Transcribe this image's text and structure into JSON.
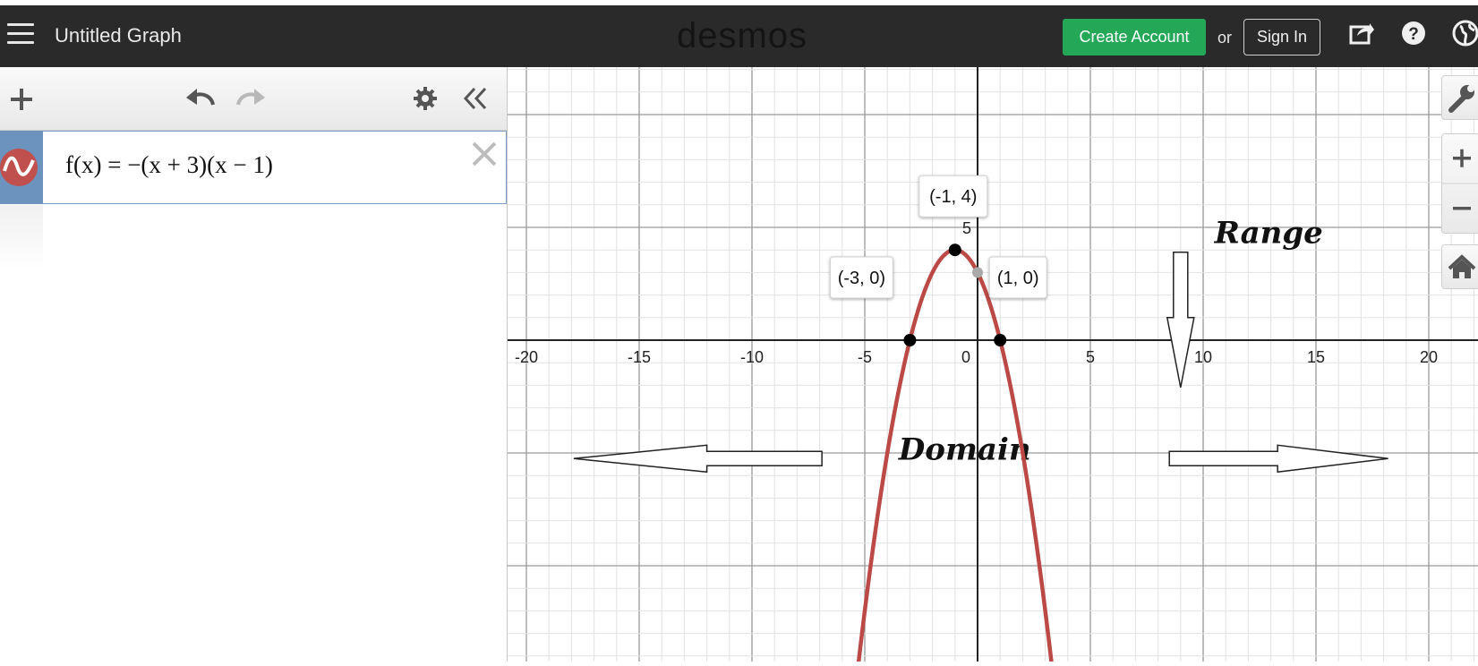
{
  "header": {
    "title": "Untitled Graph",
    "logo": "desmos",
    "create_account": "Create Account",
    "or": "or",
    "sign_in": "Sign In"
  },
  "expression_list": [
    {
      "latex_display": "f(x) = −(x + 3)(x − 1)",
      "color": "#c0504d"
    }
  ],
  "graph": {
    "x_ticks": [
      "-20",
      "-15",
      "-10",
      "-5",
      "0",
      "5",
      "10",
      "15",
      "20"
    ],
    "y_tick_label": "5",
    "point_labels": [
      "(-1, 4)",
      "(-3, 0)",
      "(1, 0)"
    ],
    "annotations": {
      "range": "Range",
      "domain": "Domain"
    },
    "curve_color": "#bb4a46"
  },
  "colors": {
    "topbar": "#2a2a2a",
    "accent_green": "#24a857",
    "expression_icon_bg": "#6b93bd"
  }
}
